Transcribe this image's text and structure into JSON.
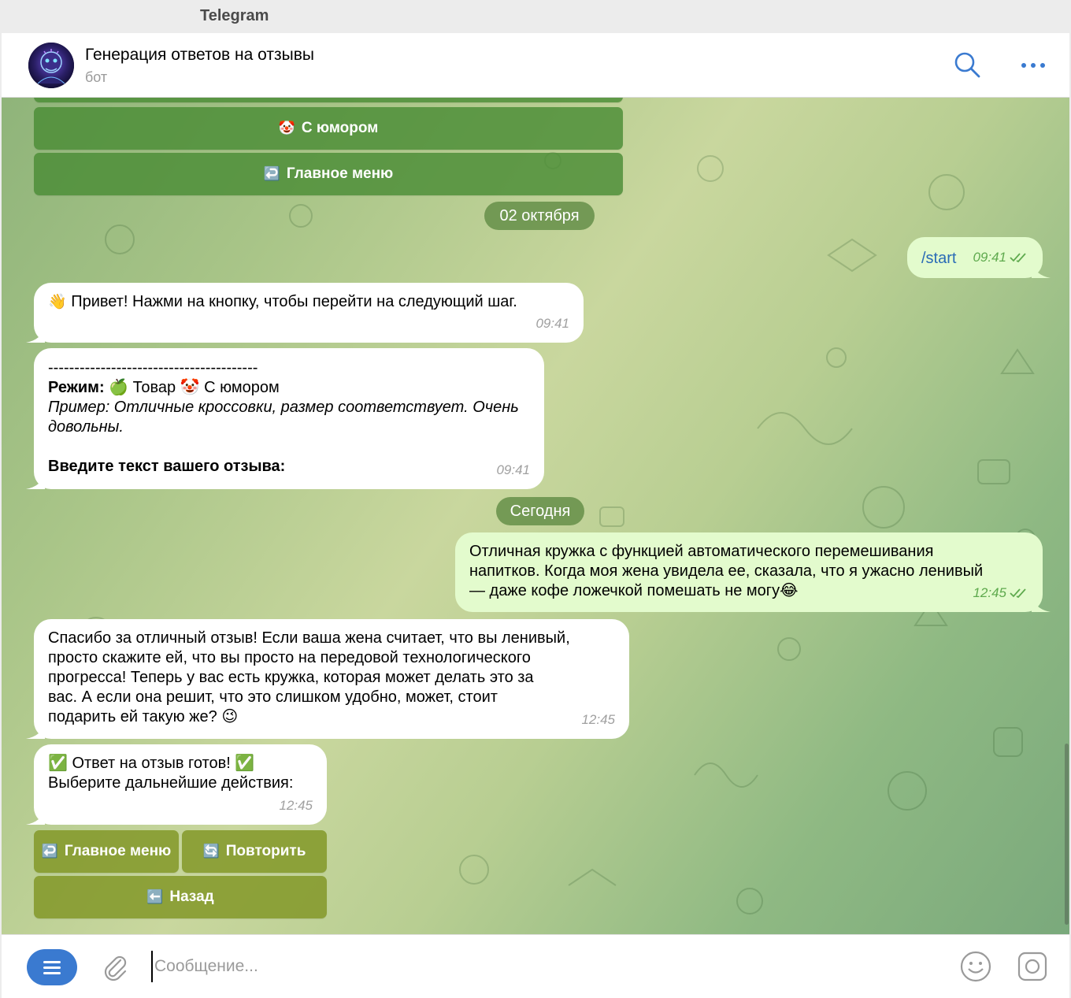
{
  "window": {
    "app_title": "Telegram"
  },
  "header": {
    "title": "Генерация ответов на отзывы",
    "subtitle": "бот",
    "search_icon": "search-icon",
    "more_icon": "more-horizontal-icon"
  },
  "top_keyboard": {
    "humor_label": "С юмором",
    "humor_emoji": "🤡",
    "main_menu_label": "Главное меню",
    "main_menu_emoji": "↩️"
  },
  "date_separators": [
    "02 октября",
    "Сегодня"
  ],
  "messages": [
    {
      "direction": "out",
      "text": "/start",
      "time": "09:41",
      "status": "read"
    },
    {
      "direction": "in",
      "emoji": "👋",
      "text": "Привет! Нажми на кнопку, чтобы перейти на следующий шаг.",
      "time": "09:41"
    },
    {
      "direction": "in",
      "divider": "----------------------------------------",
      "mode_label": "Режим:",
      "mode_emoji1": "🍏",
      "mode_value1": "Товар",
      "mode_emoji2": "🤡",
      "mode_value2": "С юмором",
      "example_line1": "Пример: Отличные кроссовки, размер соответствует. Очень",
      "example_line2": "довольны.",
      "prompt": "Введите текст вашего отзыва:",
      "time": "09:41"
    },
    {
      "direction": "out",
      "lines": [
        "Отличная кружка с функцией автоматического перемешивания",
        "напитков. Когда моя жена увидела ее, сказала, что я ужасно ленивый",
        "— даже кофе ложечкой помешать не могу"
      ],
      "trailing_emoji": "😂",
      "time": "12:45",
      "status": "read"
    },
    {
      "direction": "in",
      "lines": [
        "Спасибо за отличный отзыв! Если ваша жена считает, что вы ленивый,",
        "просто скажите ей, что вы просто на передовой технологического",
        "прогресса! Теперь у вас есть кружка, которая может делать это за",
        "вас. А если она решит, что это слишком удобно, может, стоит",
        "подарить ей такую же?"
      ],
      "trailing_emoji": "😉",
      "time": "12:45"
    },
    {
      "direction": "in",
      "emoji": "✅",
      "line1": "Ответ на отзыв готов!",
      "line2": "Выберите дальнейшие действия:",
      "time": "12:45"
    }
  ],
  "bottom_keyboard": {
    "main_menu_label": "Главное меню",
    "main_menu_emoji": "↩️",
    "repeat_label": "Повторить",
    "repeat_emoji": "🔄",
    "back_label": "Назад",
    "back_emoji": "⬅️"
  },
  "composer": {
    "placeholder": "Сообщение...",
    "value": "",
    "menu_icon": "menu-icon",
    "attach_icon": "paperclip-icon",
    "emoji_icon": "smile-icon",
    "camera_icon": "camera-icon"
  },
  "colors": {
    "accent": "#3a7ad0",
    "outgoing_bubble": "#e3fbcd",
    "keyboard_green": "#4a8c36",
    "keyboard_olive": "#829828",
    "date_pill": "#628c46"
  }
}
